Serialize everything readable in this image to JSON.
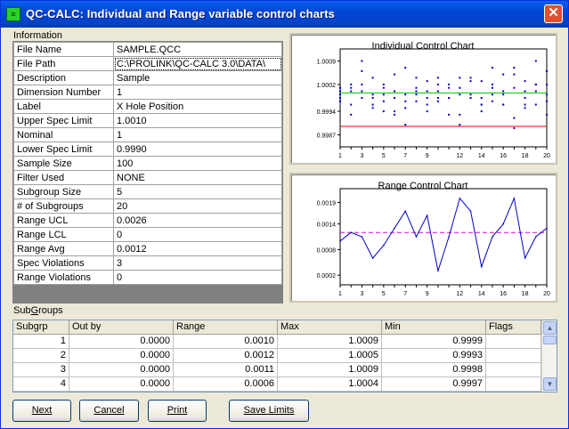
{
  "window": {
    "title": "QC-CALC: Individual and Range variable control charts",
    "icon": "app-icon",
    "close": "close-icon"
  },
  "information": {
    "label": "Information",
    "rows": [
      {
        "k": "File Name",
        "v": "SAMPLE.QCC"
      },
      {
        "k": "File Path",
        "v": "C:\\PROLINK\\QC-CALC 3.0\\DATA\\"
      },
      {
        "k": "Description",
        "v": "Sample"
      },
      {
        "k": "Dimension Number",
        "v": "1"
      },
      {
        "k": "Label",
        "v": "X Hole Position"
      },
      {
        "k": "Upper Spec Limit",
        "v": "1.0010"
      },
      {
        "k": "Nominal",
        "v": "1"
      },
      {
        "k": "Lower Spec Limit",
        "v": "0.9990"
      },
      {
        "k": "Sample Size",
        "v": "100"
      },
      {
        "k": "Filter Used",
        "v": "NONE"
      },
      {
        "k": "Subgroup Size",
        "v": "5"
      },
      {
        "k": "# of Subgroups",
        "v": "20"
      },
      {
        "k": "Range UCL",
        "v": "0.0026"
      },
      {
        "k": "Range LCL",
        "v": "0"
      },
      {
        "k": "Range Avg",
        "v": "0.0012"
      },
      {
        "k": "Spec Violations",
        "v": "3"
      },
      {
        "k": "Range Violations",
        "v": "0"
      }
    ]
  },
  "chart_data": [
    {
      "type": "scatter",
      "title": "Individual Control Chart",
      "x": [
        1,
        2,
        3,
        4,
        5,
        6,
        7,
        8,
        9,
        10,
        11,
        12,
        13,
        14,
        15,
        16,
        17,
        18,
        19,
        20
      ],
      "xticks": [
        1,
        3,
        5,
        7,
        9,
        12,
        14,
        16,
        18,
        20
      ],
      "yticks": [
        "1.0009",
        "1.0002",
        "0.9994",
        "0.9987"
      ],
      "ylim": [
        0.9985,
        1.0011
      ],
      "center_line": 0.99995,
      "lower_line": 0.99895,
      "colors": {
        "points": "#0000cc",
        "center": "#00c000",
        "lower": "#ff0000"
      },
      "series_values": [
        [
          1.0001,
          1.0,
          1.0009,
          0.9998,
          0.9997,
          1.0005,
          0.999,
          1.0004,
          1.0,
          0.9998,
          1.0001,
          1.0004,
          0.9998,
          0.9994,
          1.0007,
          0.9996,
          1.0007,
          0.9995,
          1.0009,
          0.9999
        ],
        [
          1.0,
          0.9996,
          1.0002,
          1.0004,
          0.9999,
          0.9994,
          0.9995,
          0.9999,
          0.9994,
          1.0004,
          0.9993,
          0.999,
          1.0003,
          0.9996,
          1.0001,
          0.9999,
          1.0001,
          1.0003,
          1.0002,
          1.0006
        ],
        [
          0.9997,
          1.0001,
          1.0,
          0.9995,
          1.0001,
          0.9998,
          1.0007,
          0.9997,
          0.9998,
          1.0002,
          0.9998,
          1.0001,
          0.9999,
          0.9998,
          1.0002,
          1.0005,
          1.0005,
          1.0,
          0.9996,
          0.9993
        ],
        [
          0.9998,
          1.0002,
          1.0006,
          0.9996,
          0.9994,
          0.9993,
          0.9999,
          1.0,
          1.0003,
          0.9997,
          1.0002,
          0.9999,
          1.0004,
          1.0003,
          0.9997,
          1.0,
          0.9992,
          0.9998,
          1.0,
          1.0002
        ],
        [
          0.9999,
          0.9993,
          0.9998,
          0.9999,
          1.0002,
          1.0,
          0.9997,
          1.0001,
          0.9996,
          1.0,
          0.9998,
          0.9993,
          0.9998,
          0.9996,
          0.9999,
          0.9996,
          0.9989,
          0.9996,
          1.0002,
          0.9997
        ]
      ]
    },
    {
      "type": "line",
      "title": "Range Control Chart",
      "x": [
        1,
        2,
        3,
        4,
        5,
        6,
        7,
        8,
        9,
        10,
        11,
        12,
        13,
        14,
        15,
        16,
        17,
        18,
        19,
        20
      ],
      "xticks": [
        1,
        3,
        5,
        7,
        9,
        12,
        14,
        16,
        18,
        20
      ],
      "yticks": [
        "0.0019",
        "0.0014",
        "0.0008",
        "0.0002"
      ],
      "ylim": [
        0.0001,
        0.0021
      ],
      "values": [
        0.001,
        0.0012,
        0.0011,
        0.0006,
        0.0009,
        0.0013,
        0.0017,
        0.0011,
        0.0016,
        0.0003,
        0.0011,
        0.002,
        0.0017,
        0.0004,
        0.0011,
        0.0014,
        0.002,
        0.0006,
        0.0011,
        0.0013
      ],
      "center_line": 0.0012,
      "colors": {
        "line": "#0000cc",
        "center": "#e000e0"
      }
    }
  ],
  "subgroups": {
    "label": "SubGroups",
    "columns": [
      "Subgrp",
      "Out by",
      "Range",
      "Max",
      "Min",
      "Flags"
    ],
    "rows": [
      [
        "1",
        "0.0000",
        "0.0010",
        "1.0009",
        "0.9999",
        ""
      ],
      [
        "2",
        "0.0000",
        "0.0012",
        "1.0005",
        "0.9993",
        ""
      ],
      [
        "3",
        "0.0000",
        "0.0011",
        "1.0009",
        "0.9998",
        ""
      ],
      [
        "4",
        "0.0000",
        "0.0006",
        "1.0004",
        "0.9997",
        ""
      ]
    ]
  },
  "buttons": {
    "next": "Next",
    "cancel": "Cancel",
    "print": "Print",
    "save": "Save Limits"
  }
}
